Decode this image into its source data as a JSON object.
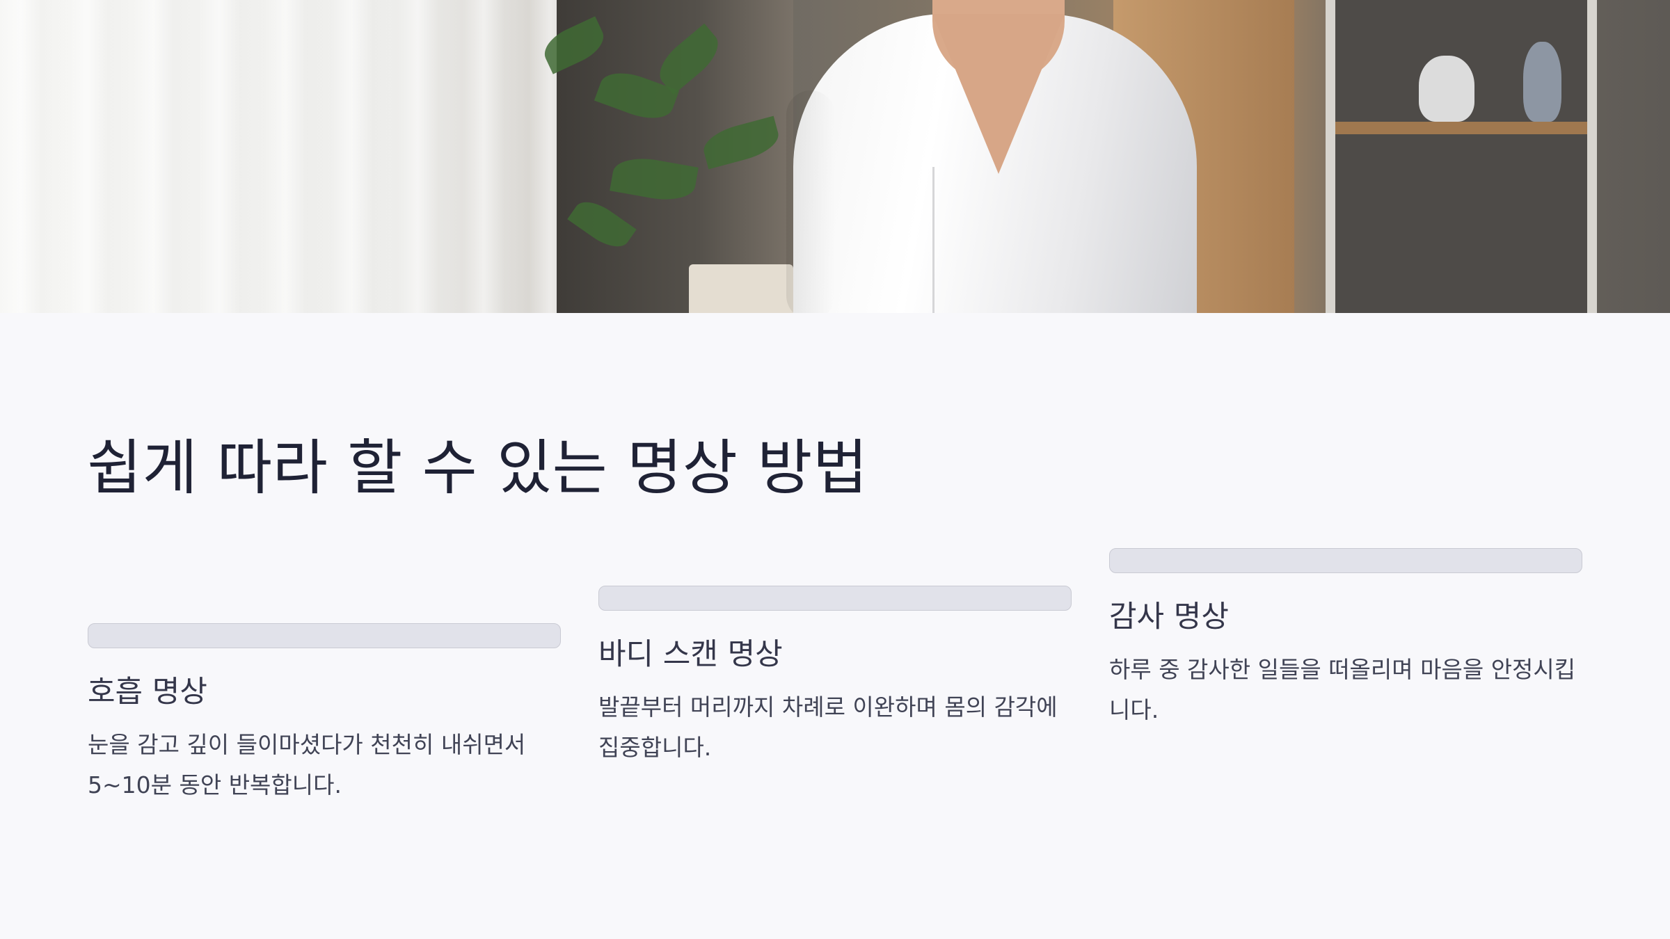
{
  "slide": {
    "title": "쉽게 따라 할 수 있는 명상 방법",
    "hero_image": "woman-in-white-shirt-meditating-photo"
  },
  "cards": [
    {
      "heading": "호흡 명상",
      "text": "눈을 감고 깊이 들이마셨다가 천천히 내쉬면서 5~10분 동안 반복합니다."
    },
    {
      "heading": "바디 스캔 명상",
      "text": "발끝부터 머리까지 차례로 이완하며 몸의 감각에 집중합니다."
    },
    {
      "heading": "감사 명상",
      "text": "하루 중 감사한 일들을 떠올리며 마음을 안정시킵니다."
    }
  ],
  "colors": {
    "background": "#f8f8fb",
    "title": "#1f2235",
    "card_bar": "#e1e2ea",
    "card_bar_border": "#c9cad3",
    "body_text": "#404355"
  }
}
